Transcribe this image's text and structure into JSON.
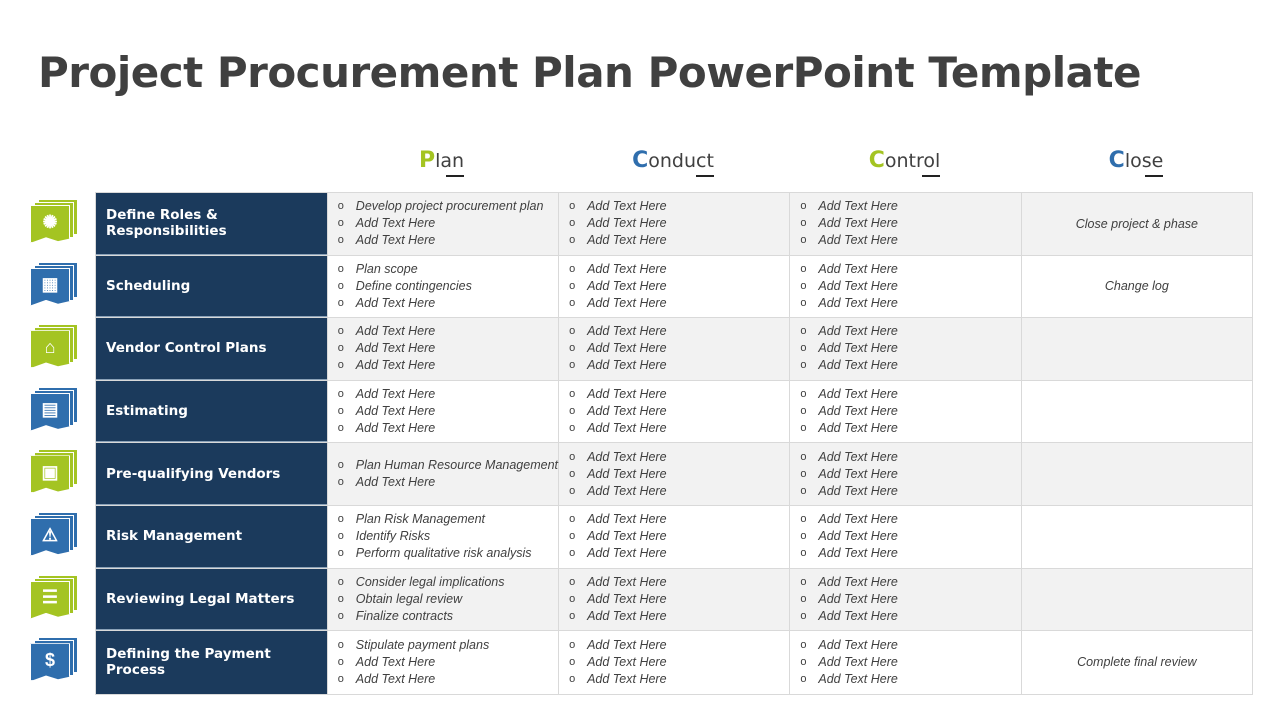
{
  "title": "Project Procurement Plan PowerPoint Template",
  "colors": {
    "green": "#a4c422",
    "blue": "#2f6ead",
    "navy": "#1b3a5c",
    "text": "#404040"
  },
  "phases": [
    {
      "first": "P",
      "rest": "lan",
      "color": "#a4c422"
    },
    {
      "first": "C",
      "rest": "onduct",
      "color": "#2f6ead"
    },
    {
      "first": "C",
      "rest": "ontrol",
      "color": "#a4c422"
    },
    {
      "first": "C",
      "rest": "lose",
      "color": "#2f6ead"
    }
  ],
  "rows": [
    {
      "label": "Define Roles & Responsibilities",
      "icon": "network-check-icon",
      "icon_glyph": "✺",
      "icon_color": "green",
      "plan": [
        "Develop project procurement plan",
        "Add Text Here",
        "Add Text Here"
      ],
      "conduct": [
        "Add Text Here",
        "Add Text Here",
        "Add Text Here"
      ],
      "control": [
        "Add Text Here",
        "Add Text Here",
        "Add Text Here"
      ],
      "close": "Close project & phase"
    },
    {
      "label": "Scheduling",
      "icon": "calendar-gear-icon",
      "icon_glyph": "▦",
      "icon_color": "blue",
      "plan": [
        "Plan scope",
        " Define contingencies",
        "Add Text Here"
      ],
      "conduct": [
        "Add Text Here",
        "Add Text Here",
        "Add Text Here"
      ],
      "control": [
        "Add Text Here",
        "Add Text Here",
        "Add Text Here"
      ],
      "close": "Change log"
    },
    {
      "label": "Vendor Control Plans",
      "icon": "storefront-gear-icon",
      "icon_glyph": "⌂",
      "icon_color": "green",
      "plan": [
        "Add Text Here",
        "Add Text Here",
        "Add Text Here"
      ],
      "conduct": [
        "Add Text Here",
        "Add Text Here",
        "Add Text Here"
      ],
      "control": [
        "Add Text Here",
        "Add Text Here",
        "Add Text Here"
      ],
      "close": ""
    },
    {
      "label": "Estimating",
      "icon": "calculator-dollar-icon",
      "icon_glyph": "▤",
      "icon_color": "blue",
      "plan": [
        "Add Text Here",
        "Add Text Here",
        "Add Text Here"
      ],
      "conduct": [
        "Add Text Here",
        "Add Text Here",
        "Add Text Here"
      ],
      "control": [
        "Add Text Here",
        "Add Text Here",
        "Add Text Here"
      ],
      "close": ""
    },
    {
      "label": "Pre-qualifying Vendors",
      "icon": "vendor-store-icon",
      "icon_glyph": "▣",
      "icon_color": "green",
      "plan": [
        "Plan Human Resource Management",
        "Add Text Here"
      ],
      "conduct": [
        "Add Text Here",
        "Add Text Here",
        "Add Text Here"
      ],
      "control": [
        "Add Text Here",
        "Add Text Here",
        "Add Text Here"
      ],
      "close": ""
    },
    {
      "label": "Risk Management",
      "icon": "warning-triangle-icon",
      "icon_glyph": "⚠",
      "icon_color": "blue",
      "plan": [
        "Plan Risk Management",
        "Identify Risks",
        "Perform qualitative risk analysis"
      ],
      "conduct": [
        "Add Text Here",
        "Add Text Here",
        "Add Text Here"
      ],
      "control": [
        "Add Text Here",
        "Add Text Here",
        "Add Text Here"
      ],
      "close": ""
    },
    {
      "label": "Reviewing Legal Matters",
      "icon": "document-check-icon",
      "icon_glyph": "☰",
      "icon_color": "green",
      "plan": [
        "Consider legal implications",
        "Obtain legal review",
        "Finalize contracts"
      ],
      "conduct": [
        "Add Text Here",
        "Add Text Here",
        "Add Text Here"
      ],
      "control": [
        "Add Text Here",
        "Add Text Here",
        "Add Text Here"
      ],
      "close": ""
    },
    {
      "label": "Defining the Payment Process",
      "icon": "dollar-cycle-icon",
      "icon_glyph": "$",
      "icon_color": "blue",
      "plan": [
        "Stipulate payment plans",
        "Add Text Here",
        "Add Text Here"
      ],
      "conduct": [
        "Add Text Here",
        "Add Text Here",
        "Add Text Here"
      ],
      "control": [
        "Add Text Here",
        "Add Text Here",
        "Add Text Here"
      ],
      "close": "Complete final review"
    }
  ]
}
